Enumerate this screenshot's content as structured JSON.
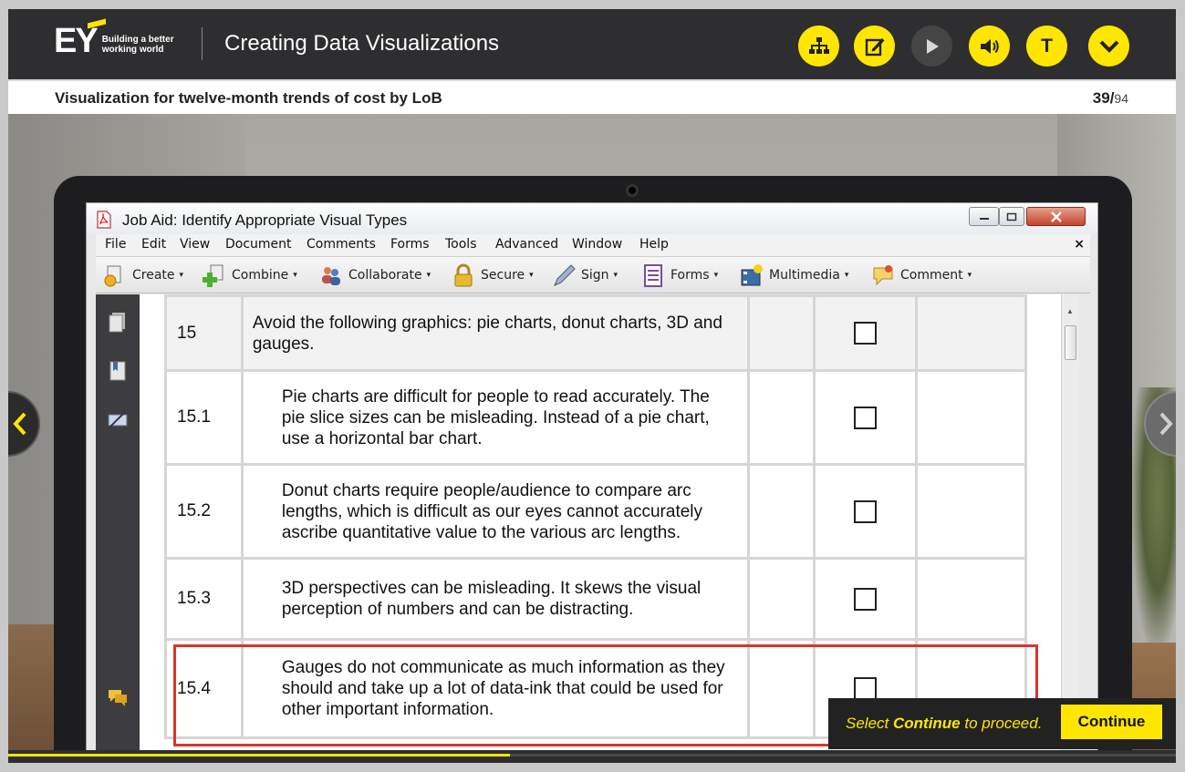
{
  "header": {
    "logo_text": "EY",
    "tagline_line1": "Building a better",
    "tagline_line2": "working world",
    "course_title": "Creating Data Visualizations",
    "buttons": [
      {
        "name": "sitemap-icon"
      },
      {
        "name": "notes-icon"
      },
      {
        "name": "play-icon"
      },
      {
        "name": "volume-icon"
      },
      {
        "name": "transcript-icon",
        "label": "T"
      },
      {
        "name": "chevron-down-icon"
      }
    ]
  },
  "slide": {
    "title": "Visualization for twelve-month trends of cost by LoB",
    "page_current": "39/",
    "page_total": "94"
  },
  "acrobat": {
    "window_title": "Job Aid: Identify Appropriate Visual Types",
    "menu": [
      "File",
      "Edit",
      "View",
      "Document",
      "Comments",
      "Forms",
      "Tools",
      "Advanced",
      "Window",
      "Help"
    ],
    "menu_close": "×",
    "toolbar": [
      "Create",
      "Combine",
      "Collaborate",
      "Secure",
      "Sign",
      "Forms",
      "Multimedia",
      "Comment"
    ],
    "dropdown_glyph": "▾"
  },
  "table": {
    "rows": [
      {
        "num": "15",
        "text": "Avoid the following graphics: pie charts, donut charts, 3D and gauges.",
        "checked": false
      },
      {
        "num": "15.1",
        "text": "Pie charts are difficult for people to read accurately. The pie slice sizes can be misleading. Instead of a pie chart, use a horizontal bar chart.",
        "checked": false
      },
      {
        "num": "15.2",
        "text": "Donut charts require people/audience to compare arc lengths, which is difficult as our eyes cannot accurately ascribe quantitative value to the various arc lengths.",
        "checked": false
      },
      {
        "num": "15.3",
        "text": "3D perspectives can be misleading. It skews the visual perception of numbers and can be distracting.",
        "checked": false
      },
      {
        "num": "15.4",
        "text": "Gauges do not communicate as much information as they should and take up a lot of data-ink that could be used for other important information.",
        "checked": false
      }
    ]
  },
  "continue_bar": {
    "prefix": "Select ",
    "bold": "Continue",
    "suffix": " to proceed.",
    "button_label": "Continue"
  },
  "progress": {
    "fraction": 0.43
  },
  "colors": {
    "accent": "#ffe600",
    "header_bg": "#2e2e30",
    "highlight": "#d9342b"
  }
}
